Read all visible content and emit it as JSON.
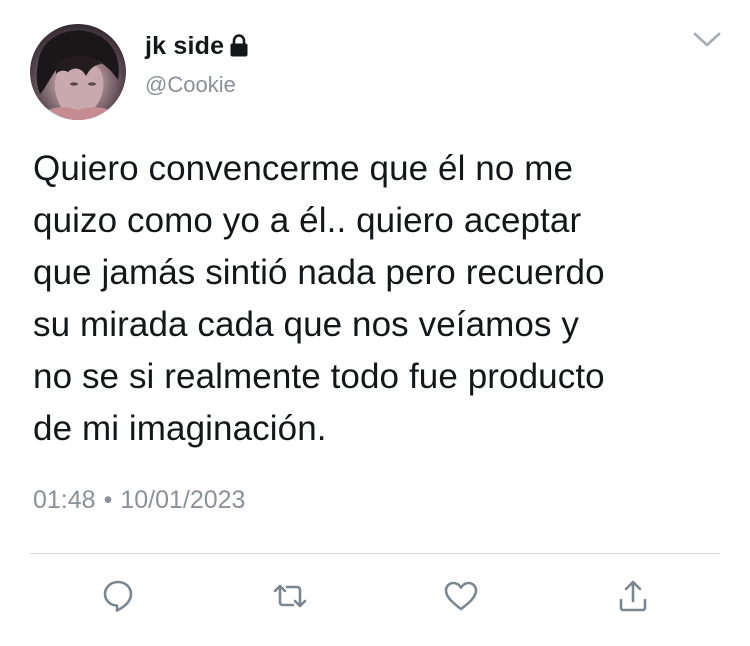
{
  "user": {
    "display_name": "jk side",
    "handle": "@Cookie",
    "lock_icon": "lock-icon",
    "avatar": "avatar"
  },
  "tweet": {
    "text": "Quiero convencerme que él no me\nquizo como yo a él.. quiero aceptar\nque jamás sintió nada pero recuerdo\nsu mirada cada que nos veíamos y\nno se si realmente todo fue producto\nde mi imaginación.",
    "time": "01:48",
    "separator": "•",
    "date": "10/01/2023"
  },
  "actions": {
    "reply_icon": "reply-icon",
    "retweet_icon": "retweet-icon",
    "like_icon": "heart-icon",
    "share_icon": "share-icon"
  },
  "colors": {
    "text": "#14171a",
    "secondary_text": "#8a9199",
    "icon": "#7a8690",
    "divider": "#d3d8dc"
  }
}
